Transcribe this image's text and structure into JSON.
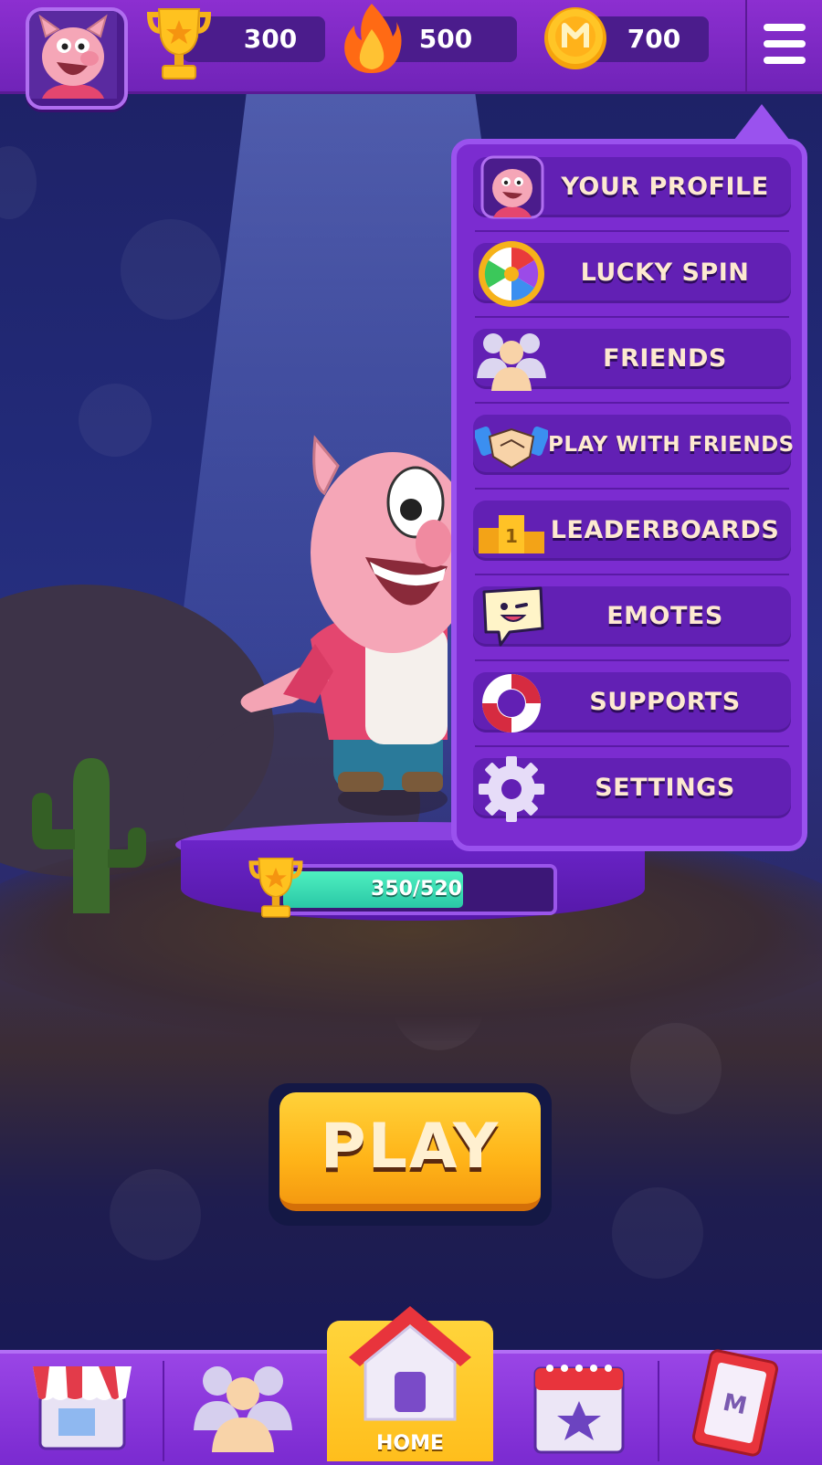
{
  "topbar": {
    "avatar_icon": "pig-avatar-icon",
    "stats": [
      {
        "icon": "trophy-icon",
        "value": "300"
      },
      {
        "icon": "fire-icon",
        "value": "500"
      },
      {
        "icon": "coin-icon",
        "value": "700"
      }
    ],
    "menu_icon": "hamburger-menu-icon"
  },
  "menu": {
    "items": [
      {
        "icon": "pig-avatar-icon",
        "label": "YOUR PROFILE"
      },
      {
        "icon": "lucky-wheel-icon",
        "label": "LUCKY SPIN"
      },
      {
        "icon": "friends-icon",
        "label": "FRIENDS"
      },
      {
        "icon": "handshake-icon",
        "label": "PLAY WITH FRIENDS"
      },
      {
        "icon": "podium-icon",
        "label": "LEADERBOARDS"
      },
      {
        "icon": "emote-icon",
        "label": "EMOTES"
      },
      {
        "icon": "lifebuoy-icon",
        "label": "SUPPORTS"
      },
      {
        "icon": "gear-icon",
        "label": "SETTINGS"
      }
    ]
  },
  "progress": {
    "text": "350/520",
    "current": 350,
    "max": 520
  },
  "play": {
    "label": "PLAY"
  },
  "bottom_nav": {
    "items": [
      {
        "icon": "shop-icon",
        "label": ""
      },
      {
        "icon": "friends-icon",
        "label": ""
      },
      {
        "icon": "home-icon",
        "label": "HOME",
        "active": true
      },
      {
        "icon": "calendar-star-icon",
        "label": ""
      },
      {
        "icon": "card-icon",
        "label": ""
      }
    ]
  },
  "colors": {
    "accent_purple": "#7b2cd0",
    "play_yellow": "#ffbe1c",
    "progress_teal": "#2ac8a6"
  }
}
